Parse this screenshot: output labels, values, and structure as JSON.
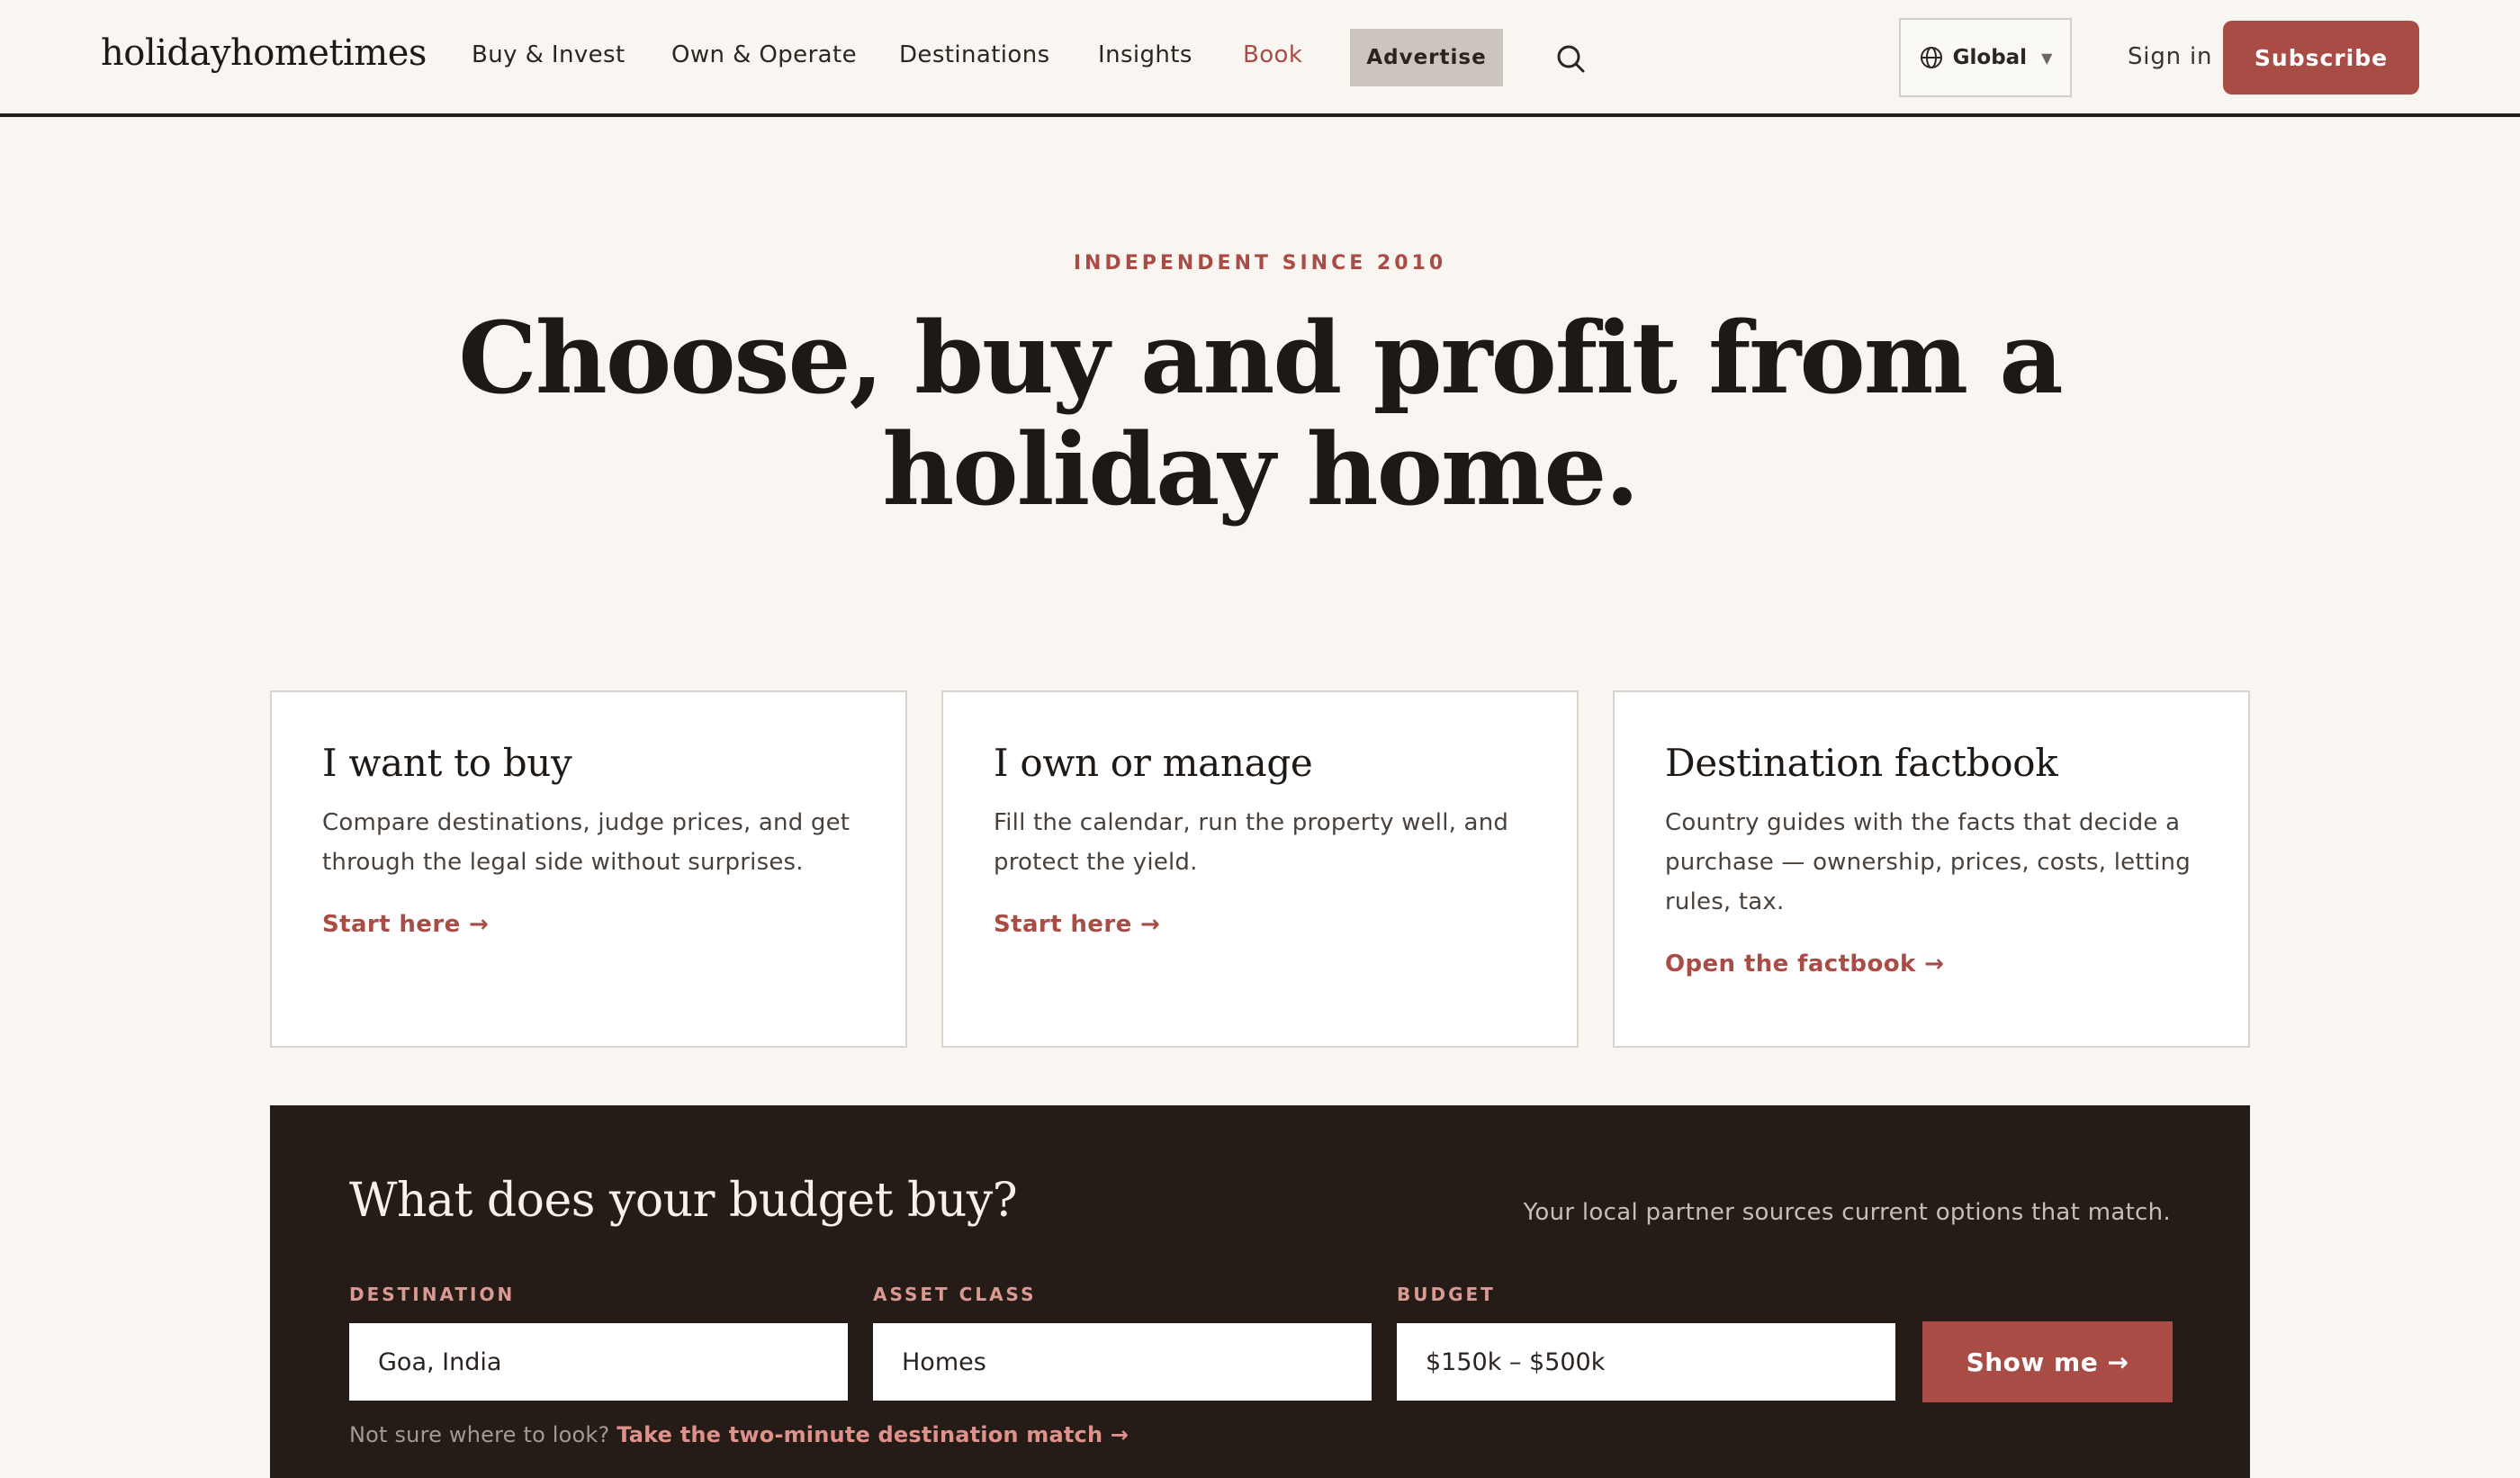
{
  "header": {
    "logo": "holidayhometimes",
    "nav": [
      {
        "label": "Buy & Invest"
      },
      {
        "label": "Own & Operate"
      },
      {
        "label": "Destinations"
      },
      {
        "label": "Insights"
      },
      {
        "label": "Book",
        "active": true
      }
    ],
    "advertise_label": "Advertise",
    "search_icon": "search-icon",
    "region": {
      "icon": "globe-icon",
      "label": "Global",
      "caret": "▼"
    },
    "signin_label": "Sign in",
    "subscribe_label": "Subscribe"
  },
  "hero": {
    "eyebrow": "INDEPENDENT SINCE 2010",
    "title": "Choose, buy and profit from a holiday home."
  },
  "cards": [
    {
      "title": "I want to buy",
      "body": "Compare destinations, judge prices, and get through the legal side without surprises.",
      "cta": "Start here →"
    },
    {
      "title": "I own or manage",
      "body": "Fill the calendar, run the property well, and protect the yield.",
      "cta": "Start here →"
    },
    {
      "title": "Destination factbook",
      "body": "Country guides with the facts that decide a purchase — ownership, prices, costs, letting rules, tax.",
      "cta": "Open the factbook →"
    }
  ],
  "budget": {
    "title": "What does your budget buy?",
    "note": "Your local partner sources current options that match.",
    "fields": [
      {
        "label": "DESTINATION",
        "value": "Goa, India"
      },
      {
        "label": "ASSET CLASS",
        "value": "Homes"
      },
      {
        "label": "BUDGET",
        "value": "$150k – $500k"
      }
    ],
    "submit_label": "Show me →",
    "hint_text": "Not sure where to look? ",
    "hint_link": "Take the two-minute destination match →"
  },
  "colors": {
    "accent": "#a94c46",
    "background": "#f9f6f1",
    "dark_panel": "#251c18",
    "advertise_bg": "#cbc5bd"
  }
}
